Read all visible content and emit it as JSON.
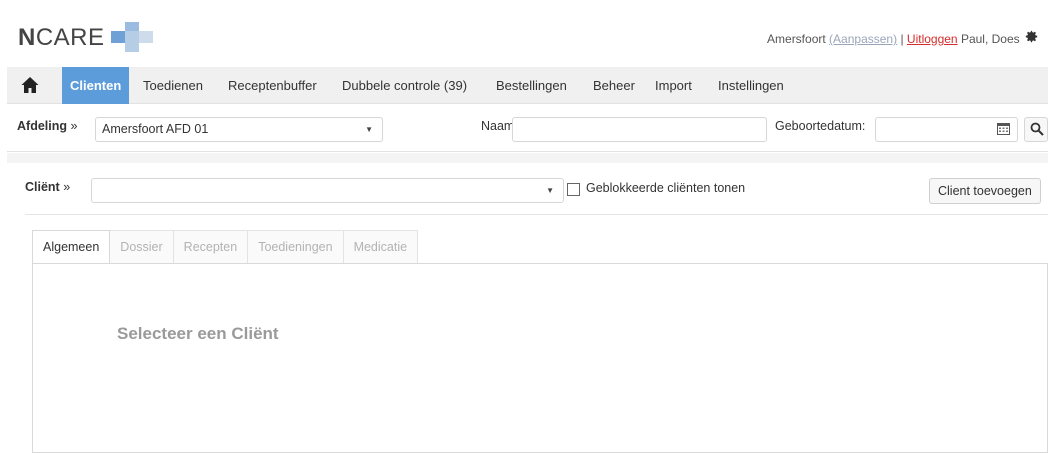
{
  "brand": {
    "logo_bold": "N",
    "logo_rest": "CARE"
  },
  "userbar": {
    "location": "Amersfoort",
    "adjust_link": "(Aanpassen)",
    "separator": "|",
    "logout_link": "Uitloggen",
    "user_name": "Paul, Does"
  },
  "nav": {
    "items": [
      {
        "label": "Clienten",
        "active": true
      },
      {
        "label": "Toedienen"
      },
      {
        "label": "Receptenbuffer"
      },
      {
        "label": "Dubbele controle (39)"
      },
      {
        "label": "Bestellingen"
      },
      {
        "label": "Beheer"
      },
      {
        "label": "Import"
      },
      {
        "label": "Instellingen"
      }
    ]
  },
  "filters": {
    "afdeling_label": "Afdeling",
    "afdeling_arrow": "»",
    "afdeling_value": "Amersfoort AFD 01",
    "naam_label": "Naam:",
    "naam_value": "",
    "geboortedatum_label": "Geboortedatum:",
    "geboortedatum_value": ""
  },
  "client": {
    "label": "Cliënt",
    "arrow": "»",
    "value": "",
    "blocked_checkbox_label": "Geblokkeerde cliënten tonen",
    "blocked_checked": false,
    "add_button": "Client toevoegen"
  },
  "tabs": [
    {
      "label": "Algemeen",
      "active": true
    },
    {
      "label": "Dossier"
    },
    {
      "label": "Recepten"
    },
    {
      "label": "Toedieningen"
    },
    {
      "label": "Medicatie"
    }
  ],
  "panel": {
    "placeholder": "Selecteer een Cliënt"
  },
  "colors": {
    "accent": "#5d9cdb",
    "logout": "#d62d2d",
    "logo_cross": "#a9c6e4"
  },
  "icons": [
    "home-icon",
    "gear-icon",
    "calendar-icon",
    "search-icon",
    "chevron-down-icon"
  ]
}
